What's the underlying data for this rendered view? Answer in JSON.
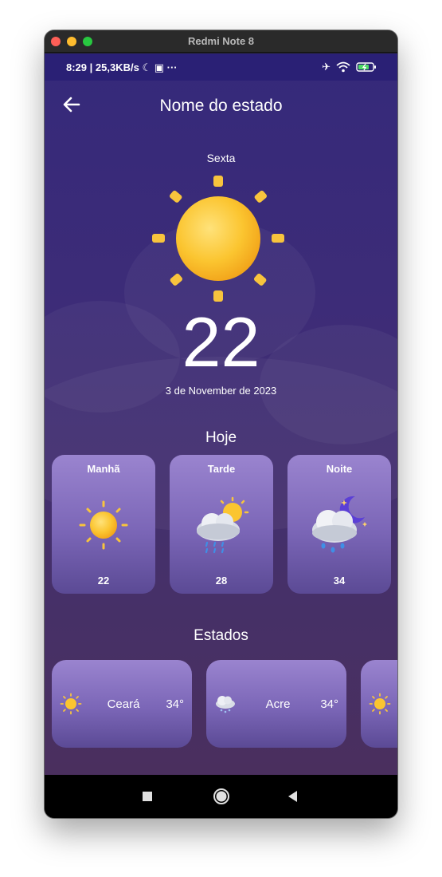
{
  "window": {
    "title": "Redmi Note 8"
  },
  "status_bar": {
    "time": "8:29 | 25,3KB/s",
    "dots": "···"
  },
  "app_bar": {
    "title": "Nome do estado"
  },
  "current": {
    "day": "Sexta",
    "temperature": "22",
    "date": "3 de November de 2023",
    "icon": "sun-icon"
  },
  "today": {
    "title": "Hoje",
    "periods": [
      {
        "name": "Manhã",
        "temp": "22",
        "icon": "sun-icon"
      },
      {
        "name": "Tarde",
        "temp": "28",
        "icon": "sun-cloud-rain-icon"
      },
      {
        "name": "Noite",
        "temp": "34",
        "icon": "moon-cloud-rain-icon"
      }
    ]
  },
  "states": {
    "title": "Estados",
    "items": [
      {
        "name": "Ceará",
        "temp": "34°",
        "icon": "sun-icon"
      },
      {
        "name": "Acre",
        "temp": "34°",
        "icon": "cloud-snow-icon"
      },
      {
        "name": "",
        "temp": "",
        "icon": "sun-icon"
      }
    ]
  },
  "colors": {
    "accent_purple": "#8f7ac6",
    "background_top": "#35297a",
    "background_bottom": "#4a2f5e",
    "sun": "#f9c52c"
  }
}
